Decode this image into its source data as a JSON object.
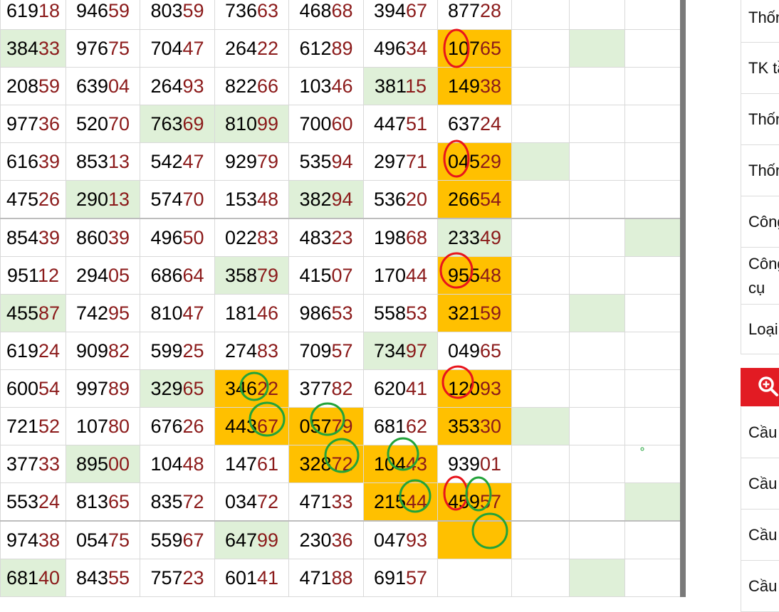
{
  "rows": [
    [
      "61918",
      "94659",
      "80359",
      "73663",
      "46868",
      "39467",
      "87728"
    ],
    [
      "38433",
      "97675",
      "70447",
      "26422",
      "61289",
      "49634",
      "10765"
    ],
    [
      "20859",
      "63904",
      "26493",
      "82266",
      "10346",
      "38115",
      "14938"
    ],
    [
      "97736",
      "52070",
      "76369",
      "81099",
      "70060",
      "44751",
      "63724"
    ],
    [
      "61639",
      "85313",
      "54247",
      "92979",
      "53594",
      "29771",
      "04529"
    ],
    [
      "47526",
      "29013",
      "57470",
      "15348",
      "38294",
      "53620",
      "26654"
    ],
    [
      "85439",
      "86039",
      "49650",
      "02283",
      "48323",
      "19868",
      "23349"
    ],
    [
      "95112",
      "29405",
      "68664",
      "35879",
      "41507",
      "17044",
      "95548"
    ],
    [
      "45587",
      "74295",
      "81047",
      "18146",
      "98653",
      "55853",
      "32159"
    ],
    [
      "61924",
      "90982",
      "59925",
      "27483",
      "70957",
      "73497",
      "04965"
    ],
    [
      "60054",
      "99789",
      "32965",
      "34622",
      "37782",
      "62041",
      "12093"
    ],
    [
      "72152",
      "10780",
      "67626",
      "44367",
      "05779",
      "68162",
      "35330"
    ],
    [
      "37733",
      "89500",
      "10448",
      "14761",
      "32872",
      "10443",
      "93901"
    ],
    [
      "55324",
      "81365",
      "83572",
      "03472",
      "47133",
      "21544",
      "45957"
    ],
    [
      "97438",
      "05475",
      "55967",
      "64799",
      "23036",
      "04793",
      ""
    ],
    [
      "68140",
      "84355",
      "75723",
      "60141",
      "47188",
      "69157",
      ""
    ]
  ],
  "sidebar": {
    "items": [
      "Thống kê",
      "TK tần suất",
      "Thống kê",
      "Thống kê",
      "Công cụ",
      "Công cụ VIP",
      "Loại",
      "Cầu",
      "Cầu",
      "Cầu",
      "Cầu"
    ],
    "search_icon": "zoom-in-icon",
    "search_color": "#e21b23"
  },
  "colors": {
    "highlight_green": "#dff0d8",
    "highlight_orange": "#ffc000",
    "circle_red": "#e8141c",
    "circle_green": "#22a33a",
    "digit_dark_red": "#8b1a1a"
  }
}
